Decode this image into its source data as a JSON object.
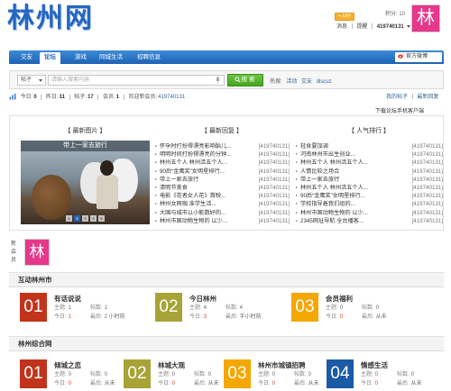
{
  "site": {
    "logo_text": "林州网"
  },
  "userbar": {
    "diy_label": "+ DIY",
    "credits": "积分: 10",
    "messages": "消息",
    "reminders": "提醒",
    "username": "419740131",
    "avatar_char": "林"
  },
  "nav": {
    "tabs": [
      "交友",
      "论坛",
      "游戏",
      "同城生活",
      "招聘信息"
    ],
    "active_tab": "论坛",
    "official_label": "官方微博"
  },
  "search": {
    "type_label": "帖子",
    "placeholder": "请输入搜索内容",
    "button_label": "搜索",
    "hot_label": "热搜:",
    "hot_terms": [
      "活动",
      "交友",
      "discuz"
    ]
  },
  "stats": {
    "items": [
      {
        "label": "今日:",
        "value": "0"
      },
      {
        "label": "昨日:",
        "value": "11"
      },
      {
        "label": "帖子:",
        "value": "17"
      },
      {
        "label": "会员:",
        "value": "1"
      }
    ],
    "new_member_label": "欢迎新会员:",
    "new_member_name": "419740131",
    "my_posts": "我的帖子",
    "latest_replies": "最新回复"
  },
  "app_download": "下载论坛手机客户端",
  "portal": {
    "headers": {
      "images": "【 最新图片 】",
      "replies": "【 最新回复 】",
      "popular": "【 人气排行 】"
    },
    "slide": {
      "caption": "带上一家去旅行",
      "dots": [
        "1",
        "2",
        "3",
        "4",
        "5"
      ],
      "active_dot": "2"
    },
    "latest": [
      {
        "title": "怀孕时打扮得漂亮影响胎儿...",
        "author": "[419740131]"
      },
      {
        "title": "明明时间打扮得漂亮的分钟...",
        "author": "[419740131]"
      },
      {
        "title": "林州五个人 林州活五个人...",
        "author": "[419740131]"
      },
      {
        "title": "90后“金鹰奖”女明星排行...",
        "author": "[419740131]"
      },
      {
        "title": "带上一家去旅行",
        "author": "[419740131]"
      },
      {
        "title": "清明节美食",
        "author": "[419740131]"
      },
      {
        "title": "电影《花者女人花》首映...",
        "author": "[419740131]"
      },
      {
        "title": "林州女网咖 准学生活...",
        "author": "[419740131]"
      },
      {
        "title": "大国与城市以小能数好的...",
        "author": "[419740131]"
      },
      {
        "title": "林州市国动物生物的 以少...",
        "author": "[419740131]"
      }
    ],
    "popular": [
      {
        "title": "轻食要加调",
        "author": "[419740131]"
      },
      {
        "title": "河南林州市出生创业...",
        "author": "[419740131]"
      },
      {
        "title": "林州五个人 林州活五个人...",
        "author": "[419740131]"
      },
      {
        "title": "人情比较之场合",
        "author": "[419740131]"
      },
      {
        "title": "带上一家去旅行",
        "author": "[419740131]"
      },
      {
        "title": "林州五个人 林州活五个人...",
        "author": "[419740131]"
      },
      {
        "title": "90后“金鹰奖”女明星排行...",
        "author": "[419740131]"
      },
      {
        "title": "学校指导着我们组的...",
        "author": "[419740131]"
      },
      {
        "title": "林州市国动物生物的 以少...",
        "author": "[419740131]"
      },
      {
        "title": "2345网址导航 全台播客...",
        "author": "[419740131]"
      }
    ]
  },
  "new_members": {
    "label": "新会员",
    "avatar_char": "林"
  },
  "forum_labels": {
    "topics": "主题:",
    "posts": "帖数:",
    "today": "今日:",
    "last": "最后:"
  },
  "categories": [
    {
      "title": "互动林州市",
      "forums": [
        {
          "num": "01",
          "title": "有话说说",
          "color": "#c1331b",
          "topics": "1",
          "posts": "1",
          "today": "1",
          "last": "2 小时前"
        },
        {
          "num": "02",
          "title": "今日林州",
          "color": "#a7a336",
          "topics": "4",
          "posts": "4",
          "today": "3",
          "last": "半小时前"
        },
        {
          "num": "03",
          "title": "会员福利",
          "color": "#f4a700",
          "topics": "0",
          "posts": "0",
          "today": "0",
          "last": "从未"
        }
      ]
    },
    {
      "title": "林州综合网",
      "forums": [
        {
          "num": "01",
          "title": "倾城之恋",
          "color": "#c1331b",
          "topics": "0",
          "posts": "0",
          "today": "0",
          "last": "从未"
        },
        {
          "num": "02",
          "title": "林城大观",
          "color": "#a7a336",
          "topics": "0",
          "posts": "0",
          "today": "0",
          "last": "从未"
        },
        {
          "num": "03",
          "title": "林州市城镇招聘",
          "color": "#f4a700",
          "topics": "0",
          "posts": "0",
          "today": "0",
          "last": "从未"
        },
        {
          "num": "04",
          "title": "情感生活",
          "color": "#1b5aa5",
          "topics": "0",
          "posts": "0",
          "today": "0",
          "last": "从未"
        }
      ]
    }
  ],
  "colors": {
    "brand_blue": "#1f62b3",
    "search_green": "#4fae28",
    "avatar_pink": "#e6378a",
    "today_red": "#e23b1e",
    "diy_orange": "#f6b130"
  }
}
